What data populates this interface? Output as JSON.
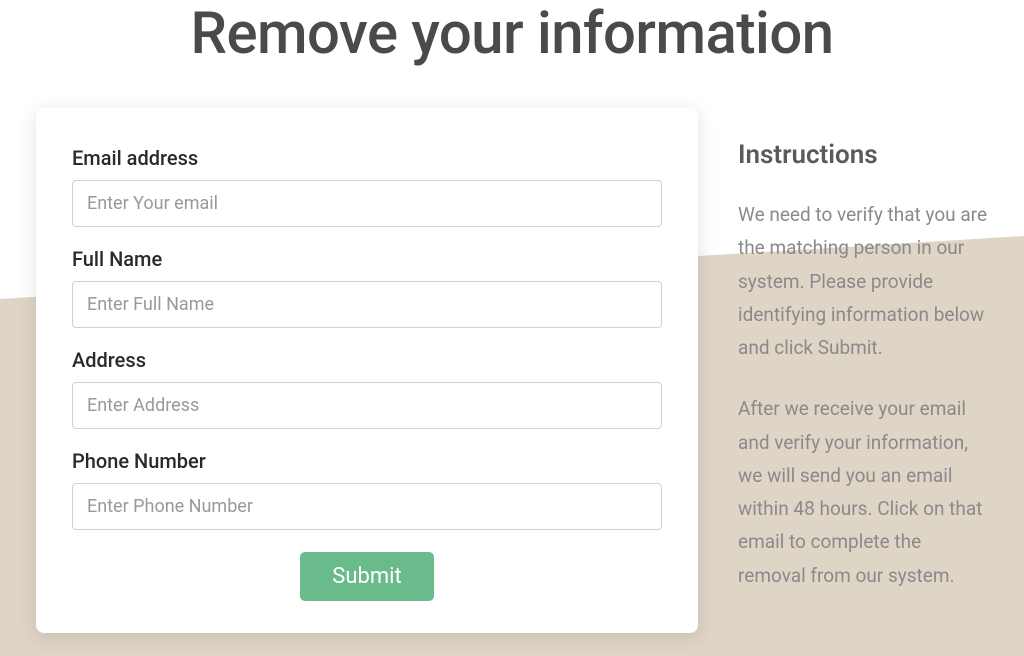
{
  "header": {
    "title": "Remove your information"
  },
  "form": {
    "email": {
      "label": "Email address",
      "placeholder": "Enter Your email",
      "value": ""
    },
    "fullName": {
      "label": "Full Name",
      "placeholder": "Enter Full Name",
      "value": ""
    },
    "address": {
      "label": "Address",
      "placeholder": "Enter Address",
      "value": ""
    },
    "phone": {
      "label": "Phone Number",
      "placeholder": "Enter Phone Number",
      "value": ""
    },
    "submit_label": "Submit"
  },
  "instructions": {
    "heading": "Instructions",
    "para1": "We need to verify that you are the matching person in our system. Please provide identifying information below and click Submit.",
    "para2": "After we receive your email and verify your information, we will send you an email within 48 hours. Click on that email to complete the removal from our system."
  }
}
